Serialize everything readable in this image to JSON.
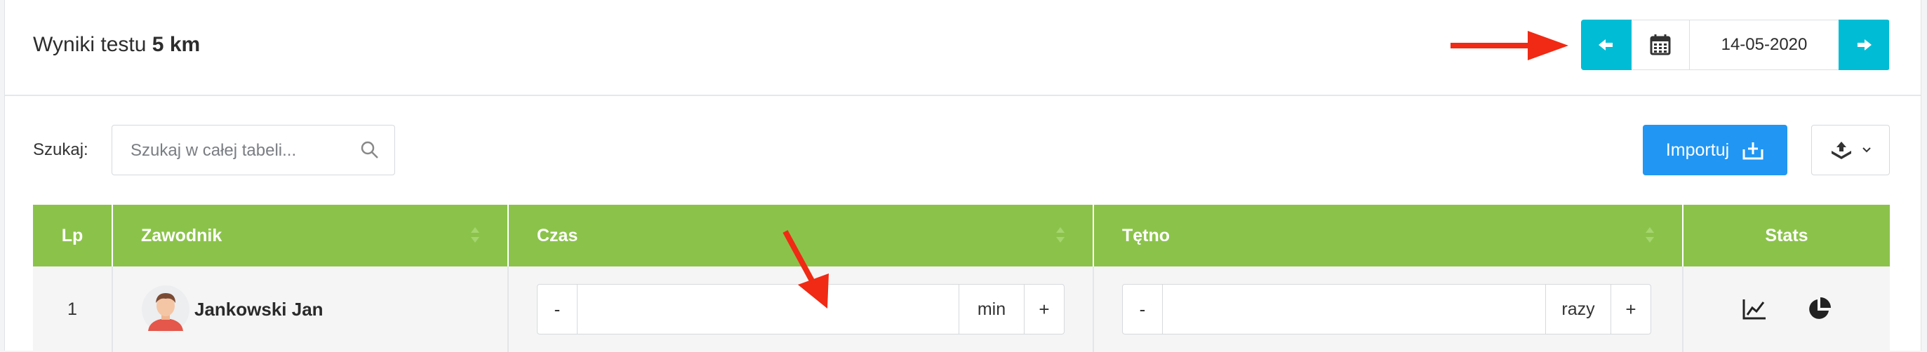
{
  "header": {
    "title_prefix": "Wyniki testu",
    "title_bold": "5 km",
    "date_value": "14-05-2020"
  },
  "toolbar": {
    "search_label": "Szukaj:",
    "search_placeholder": "Szukaj w całej tabeli...",
    "import_label": "Importuj"
  },
  "table": {
    "columns": [
      "Lp",
      "Zawodnik",
      "Czas",
      "Tętno",
      "Stats"
    ],
    "rows": [
      {
        "lp": "1",
        "name": "Jankowski Jan",
        "time_unit": "min",
        "hr_unit": "razy",
        "minus": "-",
        "plus": "+"
      }
    ]
  },
  "colors": {
    "accent_cyan": "#00bcd4",
    "header_green": "#8bc34a",
    "import_blue": "#2196f3",
    "arrow_red": "#f02a14"
  }
}
